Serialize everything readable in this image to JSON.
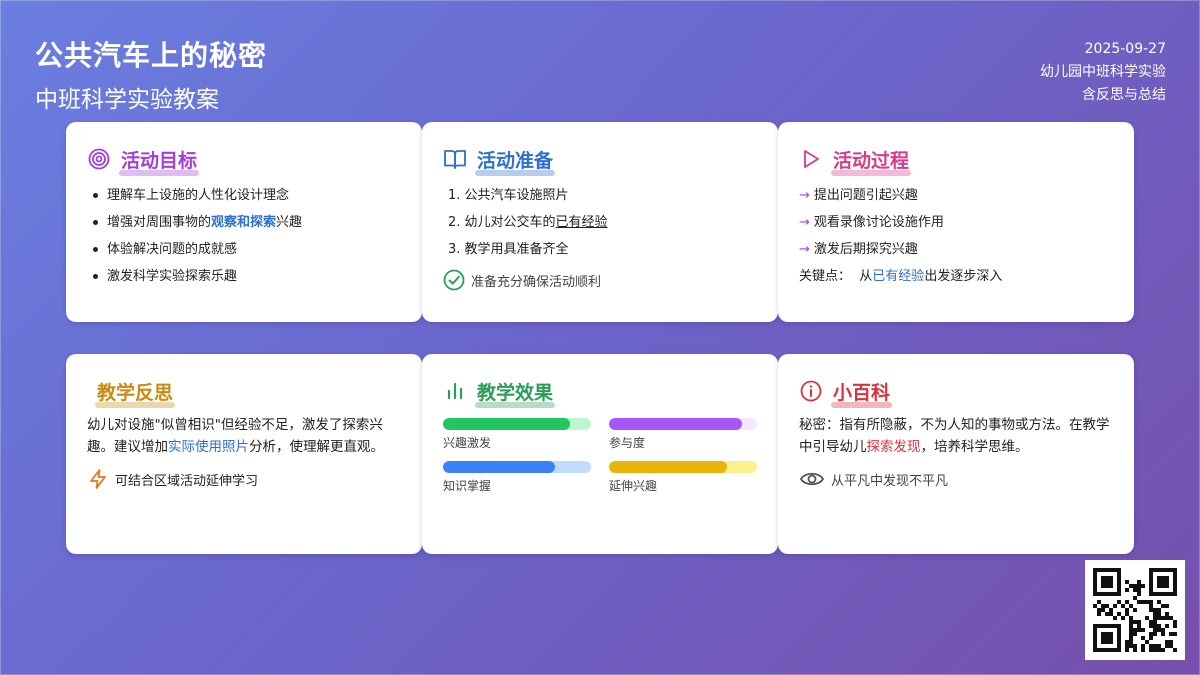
{
  "header": {
    "title": "公共汽车上的秘密",
    "subtitle": "中班科学实验教案",
    "date": "2025-09-27",
    "category": "幼儿园中班科学实验",
    "note": "含反思与总结"
  },
  "goals": {
    "title": "活动目标",
    "icon": "target-icon",
    "items": [
      "理解车上设施的人性化设计理念",
      "增强对周围事物的",
      "观察和探索",
      "兴趣",
      "体验解决问题的成就感",
      "激发科学实验探索乐趣"
    ]
  },
  "prep": {
    "title": "活动准备",
    "icon": "book-icon",
    "items": [
      "1. 公共汽车设施照片",
      "2. 幼儿对公交车的",
      "已有经验",
      "3. 教学用具准备齐全"
    ],
    "note": "准备充分确保活动顺利"
  },
  "process": {
    "title": "活动过程",
    "icon": "play-icon",
    "arrow": "→",
    "items": [
      "提出问题引起兴趣",
      "观看录像讨论设施作用",
      "激发后期探究兴趣"
    ],
    "key_label": "关键点：",
    "key_pre": "从",
    "key_hl": "已有经验",
    "key_post": "出发逐步深入"
  },
  "reflect": {
    "title": "教学反思",
    "p1": "幼儿对设施\"似曾相识\"但经验不足，激发了探索兴趣。建议增加",
    "p_hl": "实际使用照片",
    "p2": "分析，使理解更直观。",
    "note": "可结合区域活动延伸学习"
  },
  "effect": {
    "title": "教学效果",
    "icon": "bar-chart-icon",
    "metrics": [
      {
        "label": "兴趣激发",
        "value": 0.86,
        "color": "#22c55e",
        "track": "#bbf7d0"
      },
      {
        "label": "参与度",
        "value": 0.9,
        "color": "#a855f7",
        "track": "#f3e8ff"
      },
      {
        "label": "知识掌握",
        "value": 0.76,
        "color": "#3b82f6",
        "track": "#bfdbfe"
      },
      {
        "label": "延伸兴趣",
        "value": 0.8,
        "color": "#eab308",
        "track": "#fef08a"
      }
    ]
  },
  "wiki": {
    "title": "小百科",
    "icon": "info-icon",
    "p1": "秘密：指有所隐蔽，不为人知的事物或方法。在教学中引导幼儿",
    "p_hl": "探索发现",
    "p2": "，培养科学思维。",
    "note": "从平凡中发现不平凡"
  },
  "colors": {
    "purple": "#a33fd6",
    "blue": "#2f6fd1",
    "pink": "#d63b8c",
    "amber": "#c88a10",
    "green": "#2a9d57",
    "red": "#d8343b"
  }
}
